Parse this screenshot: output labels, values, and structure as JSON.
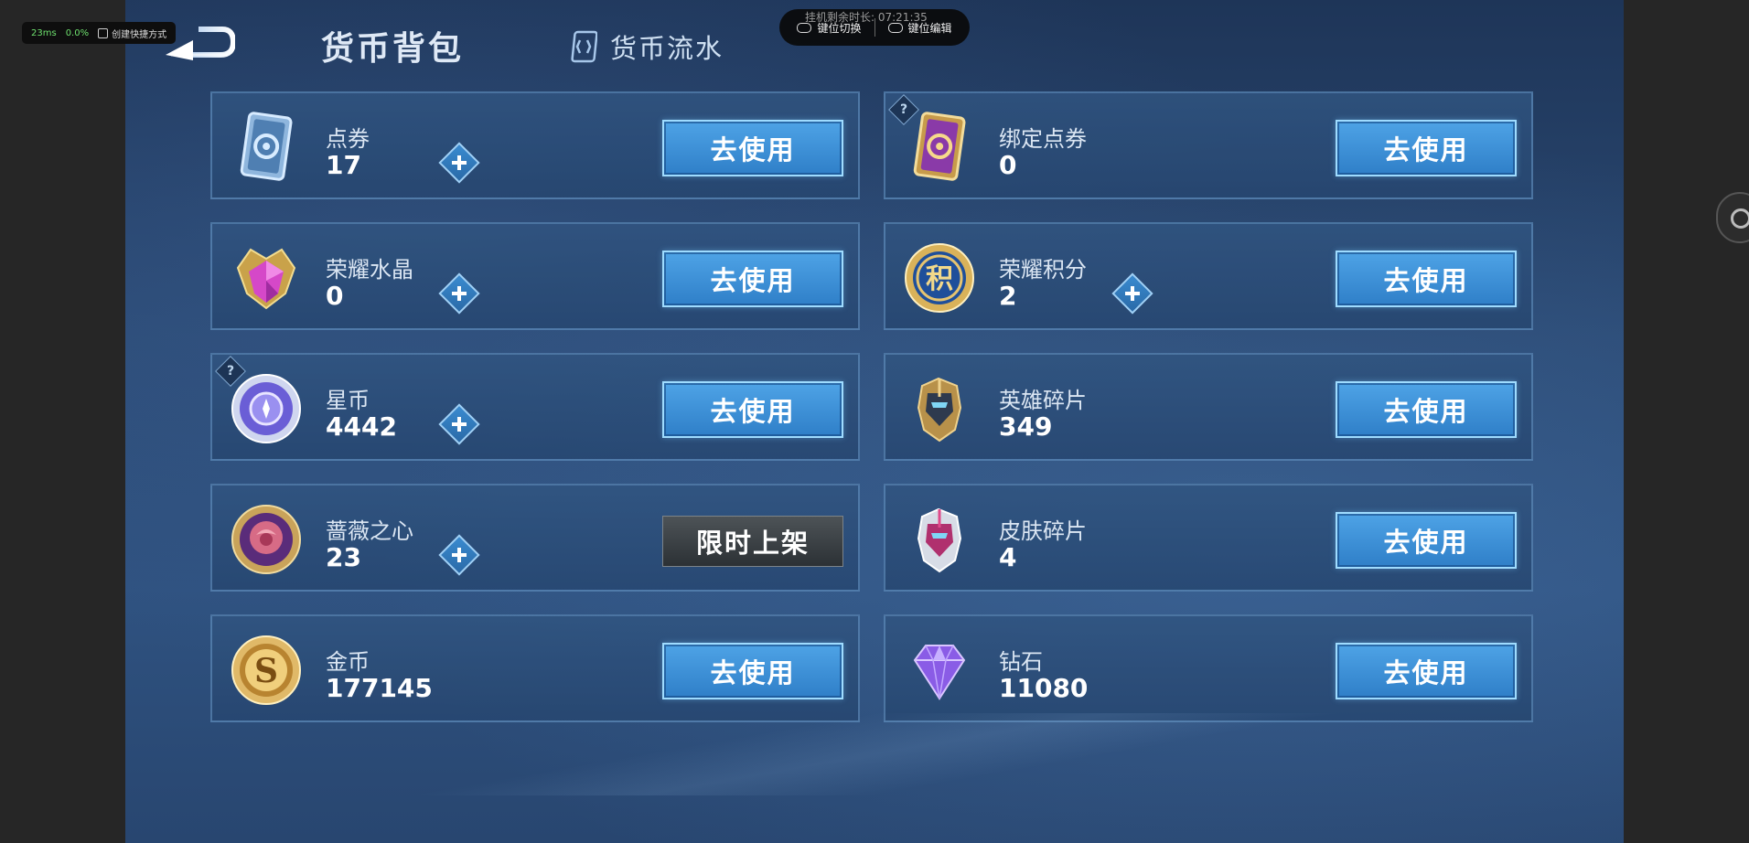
{
  "overlay": {
    "ping": "23ms",
    "loss": "0.0%",
    "shortcut_label": "创建快捷方式",
    "timer": "挂机剩余时长: 07:21:35",
    "key_switch": "键位切换",
    "key_edit": "键位编辑"
  },
  "header": {
    "title": "货币背包",
    "flow_tab": "货币流水"
  },
  "button_use": "去使用",
  "button_limited": "限时上架",
  "help_mark": "?",
  "colors": {
    "button_blue": "#3a8fd8",
    "card_bg": "#2e5483",
    "limited_gray": "#3b4044"
  },
  "currencies": {
    "left": [
      {
        "name": "点券",
        "amount": "17",
        "icon": "coupon-card-icon"
      },
      {
        "name": "荣耀水晶",
        "amount": "0",
        "icon": "glory-crystal-icon"
      },
      {
        "name": "星币",
        "amount": "4442",
        "icon": "star-coin-icon"
      },
      {
        "name": "蔷薇之心",
        "amount": "23",
        "icon": "rose-heart-icon"
      },
      {
        "name": "金币",
        "amount": "177145",
        "icon": "gold-coin-icon"
      }
    ],
    "right": [
      {
        "name": "绑定点券",
        "amount": "0",
        "icon": "bound-coupon-icon"
      },
      {
        "name": "荣耀积分",
        "amount": "2",
        "icon": "glory-points-icon"
      },
      {
        "name": "英雄碎片",
        "amount": "349",
        "icon": "hero-fragment-icon"
      },
      {
        "name": "皮肤碎片",
        "amount": "4",
        "icon": "skin-fragment-icon"
      },
      {
        "name": "钻石",
        "amount": "11080",
        "icon": "diamond-icon"
      }
    ]
  }
}
